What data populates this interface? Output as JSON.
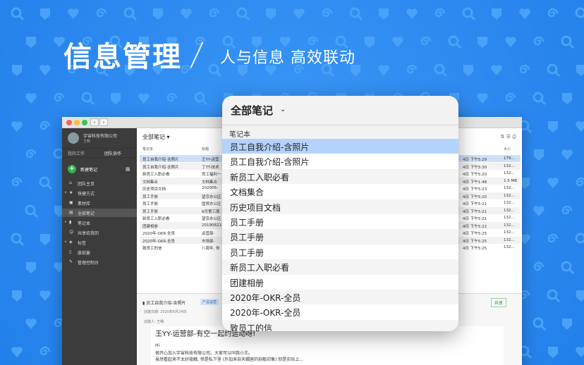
{
  "hero": {
    "title": "信息管理",
    "subtitle": "人与信息 高效联动"
  },
  "colors": {
    "background": "#2e8bf0",
    "selection": "#b3d3fc",
    "sidebar": "#3c3c3c",
    "accent_green": "#2db24a"
  },
  "sidebar": {
    "org_name": "宇宙科技有限公司",
    "user": "王畅",
    "tabs": [
      "我的工作",
      "团队协作"
    ],
    "new_note": "新建笔记",
    "items": [
      {
        "label": "团队主页",
        "icon": "home-icon"
      },
      {
        "label": "快捷方式",
        "icon": "star-icon"
      },
      {
        "label": "素材库",
        "icon": "box-icon"
      },
      {
        "label": "全部笔记",
        "icon": "notes-icon"
      },
      {
        "label": "笔记本",
        "icon": "notebook-icon"
      },
      {
        "label": "共享给我的",
        "icon": "people-icon"
      },
      {
        "label": "标签",
        "icon": "tag-icon"
      },
      {
        "label": "废纸篓",
        "icon": "trash-icon"
      },
      {
        "label": "管理控制台",
        "icon": "wrench-icon"
      }
    ]
  },
  "list": {
    "header": "全部笔记",
    "columns": [
      "笔记本",
      "标题",
      "大小"
    ],
    "rows": [
      {
        "notebook": "员工自我介绍-含照片",
        "title": "王YY-运营",
        "date": "4日 下午5:29",
        "size": "179..."
      },
      {
        "notebook": "员工自我介绍-含照片",
        "title": "丁TT-技术",
        "date": "4日 下午5:30",
        "size": "132..."
      },
      {
        "notebook": "新员工入职必看",
        "title": "员工福利一",
        "date": "4日 下午5:20",
        "size": "132..."
      },
      {
        "notebook": "文档集合",
        "title": "文档集合",
        "date": "4日 下午1:48",
        "size": "1.5 MB"
      },
      {
        "notebook": "历史项目文档",
        "title": "202006-",
        "date": "4日 下午5:23",
        "size": "132..."
      },
      {
        "notebook": "员工手册",
        "title": "望京办公区",
        "date": "4日 下午5:20",
        "size": "132..."
      },
      {
        "notebook": "员工手册",
        "title": "国贸办公区",
        "date": "4日 下午5:21",
        "size": "132..."
      },
      {
        "notebook": "员工手册",
        "title": "6月第三周",
        "date": "4日 下午5:21",
        "size": "132..."
      },
      {
        "notebook": "新员工入职必看",
        "title": "望京办公区",
        "date": "4日 下午5:21",
        "size": "132..."
      },
      {
        "notebook": "团建相册",
        "title": "20190621-",
        "date": "4日 下午5:22",
        "size": "132..."
      },
      {
        "notebook": "2020年-OKR-全员",
        "title": "运营部-",
        "date": "4日 下午5:25",
        "size": "132..."
      },
      {
        "notebook": "2020年-OKR-全员",
        "title": "市场部-",
        "date": "4日 下午5:25",
        "size": "132..."
      },
      {
        "notebook": "致员工的信",
        "title": "八周年, 你",
        "date": "4日 下午5:25",
        "size": "132..."
      }
    ]
  },
  "detail": {
    "notebook": "员工自我介绍-含照片",
    "tag": "产品运营",
    "share": "共享",
    "created": "创建日期: 2020年6月24日",
    "creator_label": "创建人:",
    "creator": "王畅",
    "heading": "王YY-运营部-有空一起约运动呀!",
    "lines": [
      "Hi",
      "很开心加入宇宙科技有限公司。大家可以叫我小王。",
      "虽然看起来不太好接触, 但是私下里 (外加来自天蝎座的刻板印象) 但是实际上..."
    ]
  },
  "popup": {
    "title": "全部笔记",
    "section": "笔记本",
    "items": [
      "员工自我介绍-含照片",
      "员工自我介绍-含照片",
      "新员工入职必看",
      "文档集合",
      "历史项目文档",
      "员工手册",
      "员工手册",
      "员工手册",
      "新员工入职必看",
      "团建相册",
      "2020年-OKR-全员",
      "2020年-OKR-全员",
      "致员工的信"
    ],
    "selected_index": 0
  }
}
